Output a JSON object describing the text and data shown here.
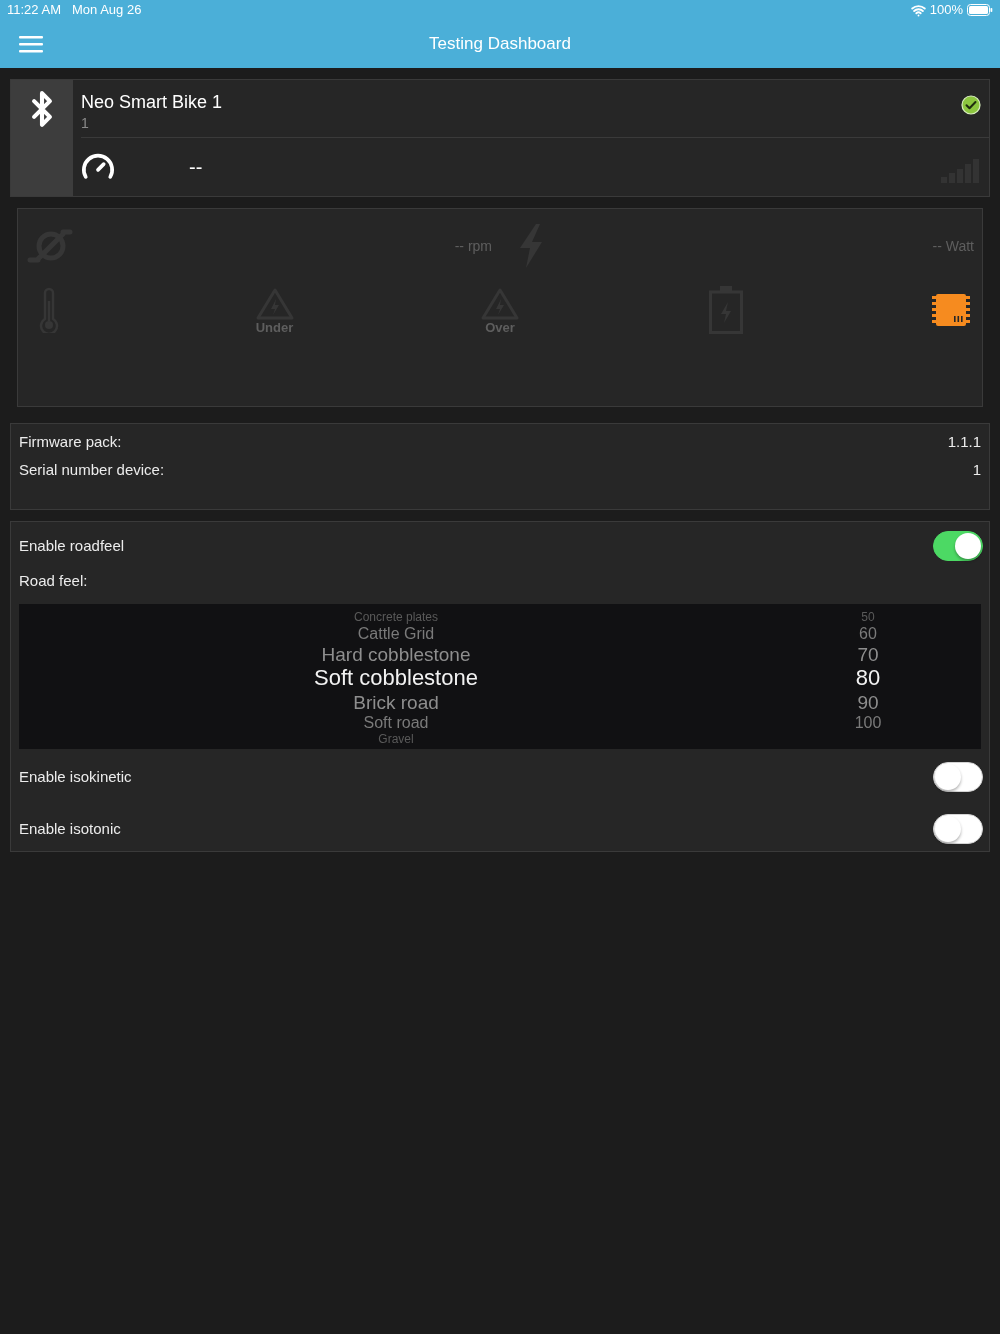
{
  "status_bar": {
    "time": "11:22 AM",
    "date": "Mon Aug 26",
    "battery": "100%"
  },
  "nav_bar": {
    "title": "Testing Dashboard"
  },
  "device": {
    "name": "Neo Smart Bike 1",
    "subtitle": "1",
    "connected": true,
    "speed": "--"
  },
  "sensors": {
    "cadence": "-- rpm",
    "power": "-- Watt",
    "indicators": [
      {
        "kind": "temperature",
        "active": false
      },
      {
        "kind": "warning",
        "label": "Under",
        "active": false
      },
      {
        "kind": "warning",
        "label": "Over",
        "active": false
      },
      {
        "kind": "battery",
        "active": false
      },
      {
        "kind": "chip",
        "active": true
      }
    ]
  },
  "info": [
    {
      "label": "Firmware pack:",
      "value": "1.1.1"
    },
    {
      "label": "Serial number device:",
      "value": "1"
    }
  ],
  "settings": [
    {
      "kind": "toggle",
      "label": "Enable roadfeel",
      "on": true
    },
    {
      "kind": "label",
      "label": "Road feel:"
    },
    {
      "kind": "picker",
      "options": [
        {
          "name": "Concrete plates",
          "value": "50",
          "selected": false
        },
        {
          "name": "Cattle Grid",
          "value": "60",
          "selected": false
        },
        {
          "name": "Hard cobblestone",
          "value": "70",
          "selected": false
        },
        {
          "name": "Soft cobblestone",
          "value": "80",
          "selected": true
        },
        {
          "name": "Brick road",
          "value": "90",
          "selected": false
        },
        {
          "name": "Soft road",
          "value": "100",
          "selected": false
        },
        {
          "name": "Gravel",
          "selected": false
        }
      ]
    },
    {
      "kind": "toggle",
      "label": "Enable isokinetic",
      "on": false
    },
    {
      "kind": "toggle",
      "label": "Enable isotonic",
      "on": false
    }
  ]
}
